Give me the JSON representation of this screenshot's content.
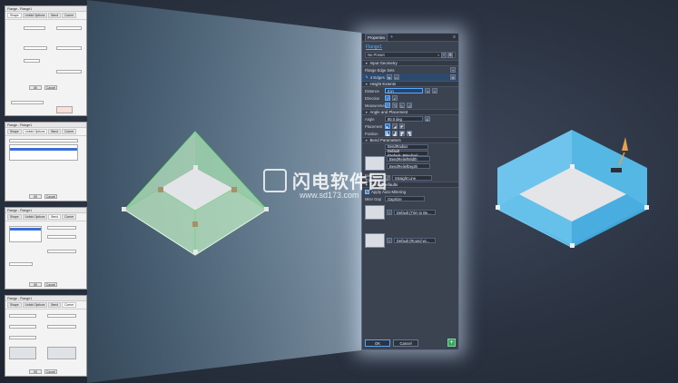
{
  "left_dialogs": [
    {
      "title": "Flange - Flange1",
      "tabs": [
        "Shape",
        "Unfold Options",
        "Bend",
        "Corner"
      ]
    },
    {
      "title": "Flange - Flange1",
      "tabs": [
        "Shape",
        "Unfold Options",
        "Bend",
        "Corner"
      ]
    },
    {
      "title": "Flange - Flange1",
      "tabs": [
        "Shape",
        "Unfold Options",
        "Bend",
        "Corner"
      ]
    },
    {
      "title": "Flange - Flange1",
      "tabs": [
        "Shape",
        "Unfold Options",
        "Bend",
        "Corner"
      ]
    }
  ],
  "dialog_buttons": {
    "ok": "OK",
    "cancel": "Cancel"
  },
  "panel": {
    "tab_label": "Properties",
    "feature_link": "Flange1",
    "preset": "No Preset",
    "sections": {
      "input_geometry": "Input Geometry",
      "height_extents": "Height Extents",
      "angle_placement": "Angle and Placement",
      "bend_parameters": "Bend Parameters",
      "corner_defaults": "Corner Defaults"
    },
    "flange_edge_sets_label": "Flange Edge Sets",
    "edge_set_item": "4 Edges",
    "distance_label": "Distance",
    "distance_value": "2 in",
    "direction_label": "Direction",
    "measurement_label": "Measurement",
    "angle_label": "Angle",
    "angle_value": "90.0 deg",
    "placement_label": "Placement",
    "position_label": "Position",
    "bend_radius": "BendRadius",
    "bend_default": "Default (Default_BRadius)",
    "bend_relief_width": "BendReliefWidth",
    "bend_relief_depth": "BendReliefDepth",
    "bend_transition_label": "Bend Transition",
    "bend_transition_value": "Straight Line",
    "apply_auto_mitering": "Apply Auto-Mitering",
    "miter_gap_label": "Miter Gap",
    "miter_gap_value": "GapSize",
    "corner_default_1": "Default (Trim to Be...",
    "corner_default_2": "Default (Round wi...",
    "ok": "OK",
    "cancel": "Cancel"
  },
  "watermark": {
    "title": "闪电软件园",
    "url": "www.sd173.com"
  },
  "colors": {
    "accent": "#59a9ff",
    "green_preview": "#9be8a0",
    "blue_result": "#4fb6e6"
  }
}
